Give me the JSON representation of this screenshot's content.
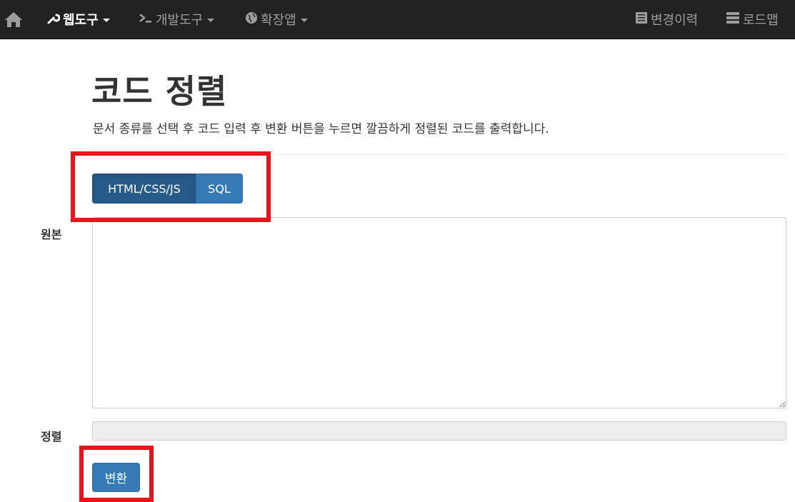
{
  "navbar": {
    "home_icon": "home-icon",
    "web_tools": "웹도구",
    "dev_tools": "개발도구",
    "ext_apps": "확장앱",
    "change_log": "변경이력",
    "roadmap": "로드맵"
  },
  "page": {
    "title": "코드 정렬",
    "description": "문서 종류를 선택 후 코드 입력 후 변환 버튼을 누르면 깔끔하게 정렬된 코드를 출력합니다."
  },
  "type_selector": {
    "options": [
      "HTML/CSS/JS",
      "SQL"
    ],
    "selected": "HTML/CSS/JS"
  },
  "form": {
    "original_label": "원본",
    "original_value": "",
    "result_label": "정렬",
    "result_value": "",
    "convert_button": "변환"
  },
  "colors": {
    "navbar_bg": "#222222",
    "primary": "#337ab7",
    "primary_active": "#265a88",
    "highlight": "#e8141c"
  }
}
